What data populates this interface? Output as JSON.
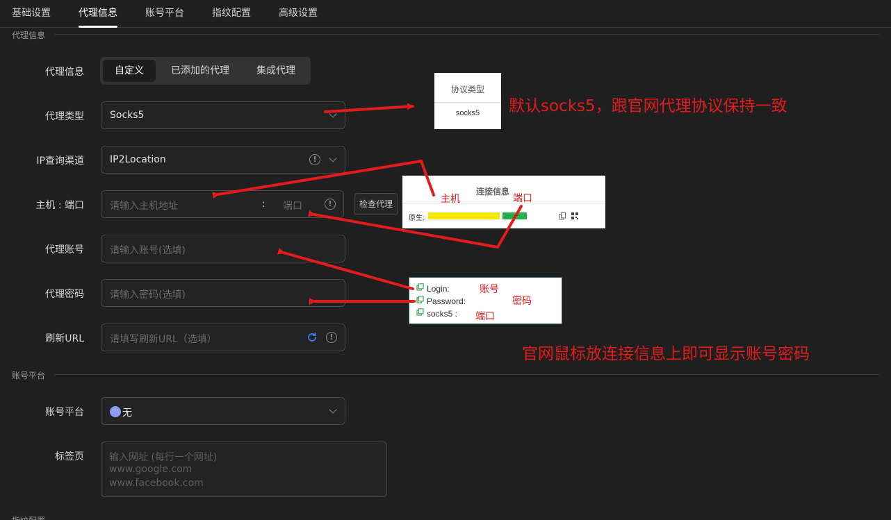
{
  "tabs": [
    "基础设置",
    "代理信息",
    "账号平台",
    "指纹配置",
    "高级设置"
  ],
  "sections": {
    "proxy": "代理信息",
    "account": "账号平台",
    "fingerprint": "指纹配置"
  },
  "form": {
    "proxy_info": {
      "label": "代理信息",
      "options": [
        "自定义",
        "已添加的代理",
        "集成代理"
      ],
      "selected": "自定义"
    },
    "proxy_type": {
      "label": "代理类型",
      "value": "Socks5"
    },
    "ip_channel": {
      "label": "IP查询渠道",
      "value": "IP2Location"
    },
    "host_port": {
      "label": "主机 : 端口",
      "host_placeholder": "请输入主机地址",
      "separator": ":",
      "port_placeholder": "端口",
      "check_button": "检查代理"
    },
    "account": {
      "label": "代理账号",
      "placeholder": "请输入账号(选填)"
    },
    "password": {
      "label": "代理密码",
      "placeholder": "请输入密码(选填)"
    },
    "refresh_url": {
      "label": "刷新URL",
      "placeholder": "请填写刷新URL（选填）"
    },
    "platform": {
      "label": "账号平台",
      "value": "无"
    },
    "tabs_page": {
      "label": "标签页",
      "placeholder_lines": [
        "输入网址 (每行一个网址)",
        "www.google.com",
        "www.facebook.com"
      ]
    }
  },
  "insets": {
    "protocol": {
      "header": "协议类型",
      "value": "socks5"
    },
    "connection": {
      "header": "连接信息",
      "row_label": "原生:"
    },
    "credentials": {
      "lines": [
        "Login:",
        "Password:",
        "socks5 :"
      ]
    }
  },
  "annotations": {
    "default_note": "默认socks5，跟官网代理协议保持一致",
    "host": "主机",
    "port1": "端口",
    "account": "账号",
    "password": "密码",
    "port2": "端口",
    "hover_note": "官网鼠标放连接信息上即可显示账号密码"
  },
  "colors": {
    "background": "#1f1f1f",
    "annotation_red": "#e21c1c",
    "refresh_blue": "#3b82f6",
    "mask_yellow": "#f5e60a",
    "mask_green": "#22b14c",
    "copy_green": "#3aa655"
  }
}
